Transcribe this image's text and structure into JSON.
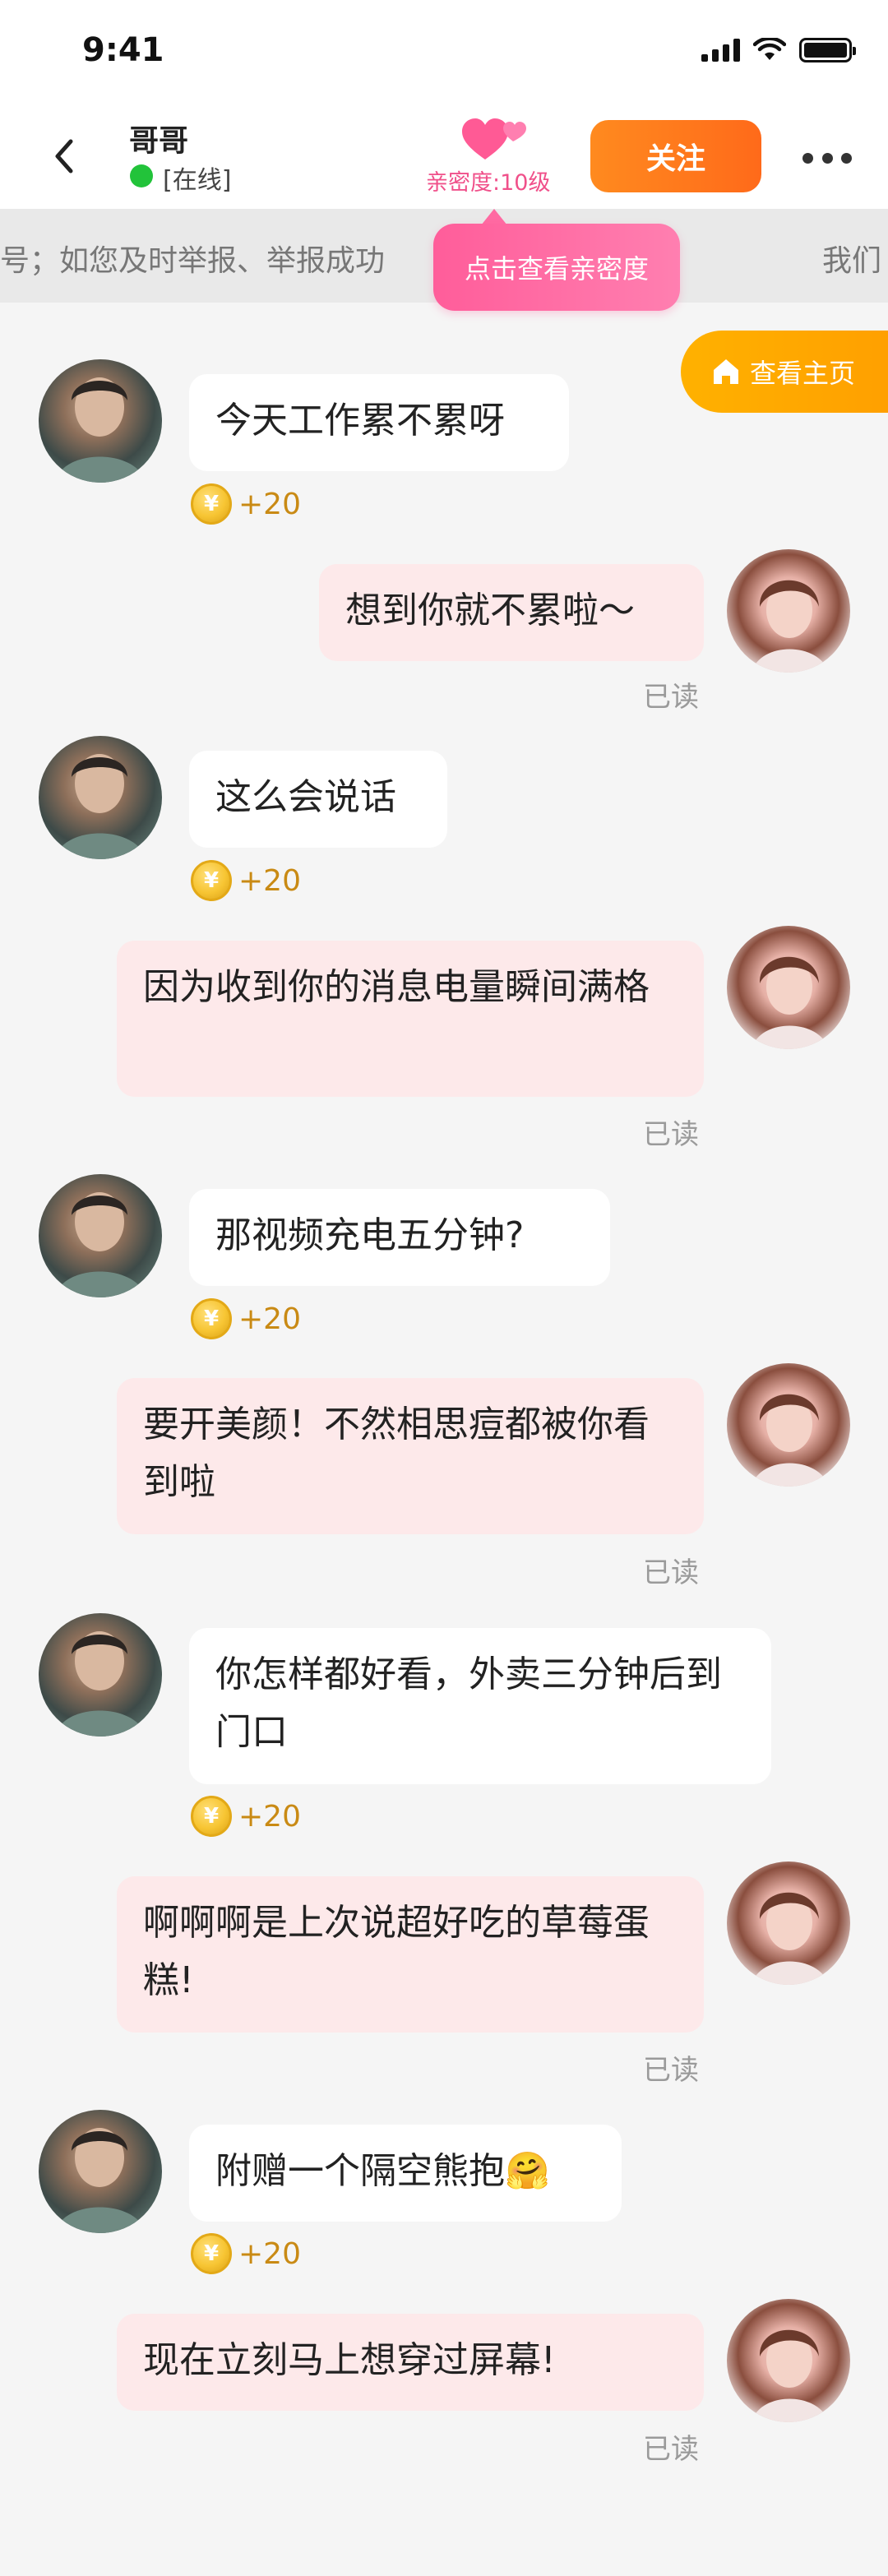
{
  "status_bar": {
    "time": "9:41"
  },
  "header": {
    "contact_name": "哥哥",
    "online_status": "[在线]",
    "intimacy_label": "亲密度:10级",
    "follow_label": "关注"
  },
  "notice": {
    "text": "号；如您及时举报、举报成功",
    "text_right": "我们"
  },
  "tooltip": {
    "text": "点击查看亲密度"
  },
  "homepage_button": {
    "label": "查看主页"
  },
  "coin_symbol": "¥",
  "messages": [
    {
      "side": "in",
      "text": "今天工作累不累呀",
      "reward": "+20"
    },
    {
      "side": "out",
      "text": "想到你就不累啦～",
      "status": "已读"
    },
    {
      "side": "in",
      "text": "这么会说话",
      "reward": "+20"
    },
    {
      "side": "out",
      "text": "因为收到你的消息电量瞬间满格",
      "status": "已读"
    },
    {
      "side": "in",
      "text": "那视频充电五分钟?",
      "reward": "+20"
    },
    {
      "side": "out",
      "text": "要开美颜！不然相思痘都被你看到啦",
      "status": "已读"
    },
    {
      "side": "in",
      "text": "你怎样都好看，外卖三分钟后到门口",
      "reward": "+20"
    },
    {
      "side": "out",
      "text": "啊啊啊是上次说超好吃的草莓蛋糕!",
      "status": "已读"
    },
    {
      "side": "in",
      "text": "附赠一个隔空熊抱🤗",
      "reward": "+20"
    },
    {
      "side": "out",
      "text": "现在立刻马上想穿过屏幕!",
      "status": "已读"
    }
  ],
  "colors": {
    "follow_button": "#ff7a1c",
    "intimacy_pink": "#f0508a",
    "homepage_button": "#ffa800",
    "outgoing_bubble": "#fde9ea",
    "incoming_bubble": "#ffffff",
    "online_dot": "#22c33a"
  }
}
